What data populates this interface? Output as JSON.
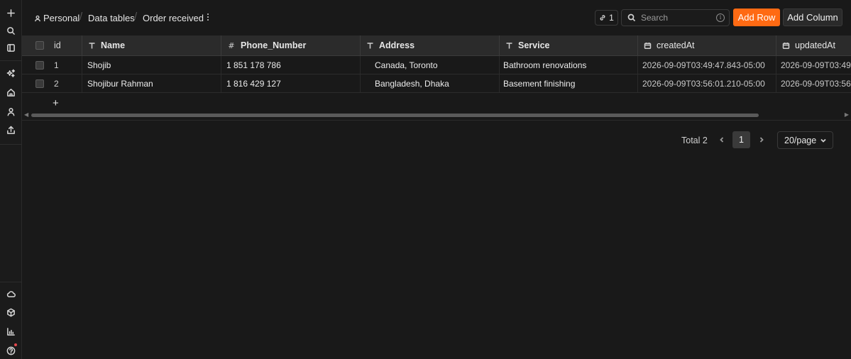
{
  "rail": {
    "top_icons": [
      "plus-icon",
      "search-icon",
      "panel-icon",
      "sparkles-icon",
      "home-icon",
      "user-icon",
      "upload-icon"
    ],
    "bottom_icons": [
      "cloud-icon",
      "cube-icon",
      "chart-icon",
      "help-icon"
    ]
  },
  "breadcrumb": {
    "workspace": "Personal",
    "section": "Data tables",
    "current": "Order received"
  },
  "toolbar": {
    "share_count": "1",
    "search_placeholder": "Search",
    "add_row_label": "Add Row",
    "add_column_label": "Add Column"
  },
  "table": {
    "columns": [
      {
        "key": "id",
        "label": "id",
        "icon": ""
      },
      {
        "key": "name",
        "label": "Name",
        "icon": "text-type-icon"
      },
      {
        "key": "phone",
        "label": "Phone_Number",
        "icon": "number-hash-icon"
      },
      {
        "key": "address",
        "label": "Address",
        "icon": "text-type-icon"
      },
      {
        "key": "service",
        "label": "Service",
        "icon": "text-type-icon"
      },
      {
        "key": "createdAt",
        "label": "createdAt",
        "icon": "calendar-icon"
      },
      {
        "key": "updatedAt",
        "label": "updatedAt",
        "icon": "calendar-icon"
      }
    ],
    "rows": [
      {
        "id": "1",
        "name": "Shojib",
        "phone": "1 851 178 786",
        "address": "Canada, Toronto",
        "service": "Bathroom renovations",
        "createdAt": "2026-09-09T03:49:47.843-05:00",
        "updatedAt": "2026-09-09T03:49:"
      },
      {
        "id": "2",
        "name": "Shojibur Rahman",
        "phone": "1 816 429 127",
        "address": "Bangladesh, Dhaka",
        "service": "Basement finishing",
        "createdAt": "2026-09-09T03:56:01.210-05:00",
        "updatedAt": "2026-09-09T03:56:"
      }
    ],
    "add_row_symbol": "+"
  },
  "pagination": {
    "total_label": "Total 2",
    "current_page": "1",
    "page_size": "20/page"
  },
  "colors": {
    "accent": "#ff6a13",
    "background": "#191919",
    "header_bg": "#2b2b2b"
  }
}
